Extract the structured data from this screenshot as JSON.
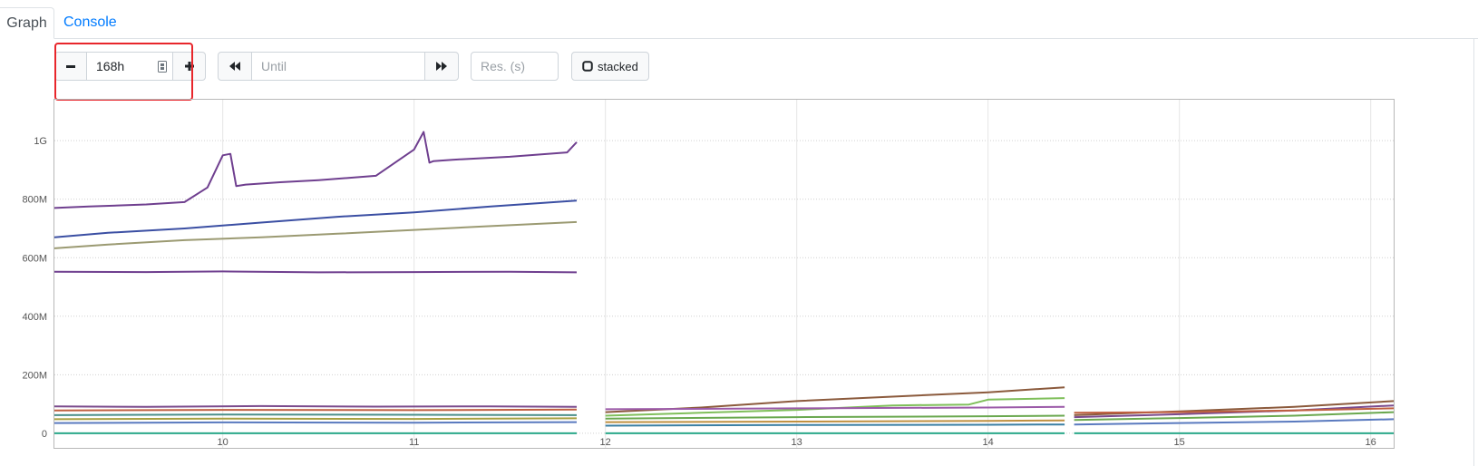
{
  "tabs": {
    "graph": "Graph",
    "console": "Console"
  },
  "controls": {
    "range_value": "168h",
    "until_placeholder": "Until",
    "resolution_placeholder": "Res. (s)",
    "stacked_label": "stacked"
  },
  "icons": {
    "minus": "minus-icon",
    "plus": "plus-icon",
    "calendar": "calendar-icon",
    "backward": "fast-backward-icon",
    "forward": "fast-forward-icon",
    "checkbox": "checkbox-icon"
  },
  "colors": {
    "highlight": "#e8262b",
    "link": "#007bff",
    "grid": "#d9d9d9"
  },
  "chart_data": {
    "type": "line",
    "ylim": [
      -50000000,
      1140000000
    ],
    "xlim": [
      9.12,
      16.12
    ],
    "y_ticks": [
      {
        "value": 0,
        "label": "0"
      },
      {
        "value": 200000000,
        "label": "200M"
      },
      {
        "value": 400000000,
        "label": "400M"
      },
      {
        "value": 600000000,
        "label": "600M"
      },
      {
        "value": 800000000,
        "label": "800M"
      },
      {
        "value": 1000000000,
        "label": "1G"
      }
    ],
    "x_ticks": [
      {
        "value": 10,
        "label": "10"
      },
      {
        "value": 11,
        "label": "11"
      },
      {
        "value": 12,
        "label": "12"
      },
      {
        "value": 13,
        "label": "13"
      },
      {
        "value": 14,
        "label": "14"
      },
      {
        "value": 15,
        "label": "15"
      },
      {
        "value": 16,
        "label": "16"
      }
    ],
    "series": [
      {
        "color": "#6f3f8f",
        "x": [
          9.12,
          9.3,
          9.6,
          9.8,
          9.92,
          10.0,
          10.04,
          10.07,
          10.12,
          10.3,
          10.5,
          10.8,
          11.0,
          11.05,
          11.08,
          11.1,
          11.2,
          11.5,
          11.8,
          11.85
        ],
        "y": [
          770000000,
          775000000,
          782000000,
          790000000,
          840000000,
          950000000,
          955000000,
          845000000,
          850000000,
          858000000,
          865000000,
          880000000,
          970000000,
          1030000000,
          925000000,
          930000000,
          935000000,
          945000000,
          960000000,
          995000000
        ]
      },
      {
        "color": "#3b4fa3",
        "x": [
          9.12,
          9.4,
          9.8,
          10.2,
          10.6,
          11.0,
          11.4,
          11.85
        ],
        "y": [
          670000000,
          685000000,
          700000000,
          720000000,
          740000000,
          755000000,
          775000000,
          795000000
        ]
      },
      {
        "color": "#9b9a72",
        "x": [
          9.12,
          9.4,
          9.8,
          10.2,
          10.6,
          11.0,
          11.4,
          11.85
        ],
        "y": [
          632000000,
          645000000,
          660000000,
          670000000,
          682000000,
          695000000,
          708000000,
          722000000
        ]
      },
      {
        "color": "#6f3f8f",
        "x": [
          9.12,
          9.6,
          10.0,
          10.5,
          11.0,
          11.5,
          11.85
        ],
        "y": [
          552000000,
          551000000,
          553000000,
          550000000,
          551000000,
          552000000,
          550000000
        ]
      },
      {
        "color": "#8b5a3c",
        "x": [
          12.0,
          12.5,
          13.0,
          13.5,
          14.0,
          14.4
        ],
        "y": [
          72000000,
          88000000,
          110000000,
          125000000,
          140000000,
          157000000
        ]
      },
      {
        "color": "#7fbf5a",
        "x": [
          12.0,
          12.5,
          13.0,
          13.5,
          13.9,
          14.0,
          14.4
        ],
        "y": [
          60000000,
          70000000,
          80000000,
          95000000,
          98000000,
          115000000,
          120000000
        ]
      },
      {
        "color": "#7a4a8c",
        "x": [
          9.12,
          9.6,
          10.2,
          10.8,
          11.4,
          11.85
        ],
        "y": [
          92000000,
          90000000,
          93000000,
          91000000,
          92000000,
          90000000
        ]
      },
      {
        "color": "#c06040",
        "x": [
          9.12,
          10.0,
          11.0,
          11.85
        ],
        "y": [
          78000000,
          80000000,
          79000000,
          81000000
        ]
      },
      {
        "color": "#4a8f8a",
        "x": [
          9.12,
          10.0,
          11.0,
          11.85
        ],
        "y": [
          62000000,
          64000000,
          63000000,
          62000000
        ]
      },
      {
        "color": "#a8a040",
        "x": [
          9.12,
          10.0,
          11.0,
          11.85
        ],
        "y": [
          48000000,
          50000000,
          49000000,
          51000000
        ]
      },
      {
        "color": "#5a7abf",
        "x": [
          9.12,
          10.0,
          11.0,
          11.85
        ],
        "y": [
          35000000,
          37000000,
          36000000,
          38000000
        ]
      },
      {
        "color": "#6aa84f",
        "x": [
          12.0,
          13.0,
          14.0,
          14.4
        ],
        "y": [
          50000000,
          55000000,
          58000000,
          60000000
        ]
      },
      {
        "color": "#9b5aa8",
        "x": [
          12.0,
          13.0,
          14.0,
          14.4
        ],
        "y": [
          82000000,
          85000000,
          88000000,
          90000000
        ]
      },
      {
        "color": "#c09040",
        "x": [
          12.0,
          13.0,
          14.0,
          14.4
        ],
        "y": [
          38000000,
          40000000,
          42000000,
          44000000
        ]
      },
      {
        "color": "#3b7fa3",
        "x": [
          12.0,
          13.0,
          14.0,
          14.4
        ],
        "y": [
          26000000,
          28000000,
          29000000,
          30000000
        ]
      },
      {
        "color": "#8b5a3c",
        "x": [
          14.45,
          15.0,
          15.6,
          16.12
        ],
        "y": [
          62000000,
          75000000,
          90000000,
          110000000
        ]
      },
      {
        "color": "#7a4a8c",
        "x": [
          14.45,
          15.0,
          15.6,
          16.12
        ],
        "y": [
          55000000,
          65000000,
          78000000,
          95000000
        ]
      },
      {
        "color": "#6aa84f",
        "x": [
          14.45,
          15.0,
          15.6,
          16.12
        ],
        "y": [
          45000000,
          52000000,
          60000000,
          72000000
        ]
      },
      {
        "color": "#5a7abf",
        "x": [
          14.45,
          15.0,
          15.6,
          16.12
        ],
        "y": [
          30000000,
          35000000,
          40000000,
          48000000
        ]
      },
      {
        "color": "#c06040",
        "x": [
          14.45,
          15.0,
          15.6,
          16.12
        ],
        "y": [
          70000000,
          72000000,
          78000000,
          85000000
        ]
      },
      {
        "color": "#2aa889",
        "x": [
          9.12,
          11.85
        ],
        "y": [
          0,
          0
        ]
      },
      {
        "color": "#2aa889",
        "x": [
          12.0,
          14.4
        ],
        "y": [
          0,
          0
        ]
      },
      {
        "color": "#2aa889",
        "x": [
          14.45,
          16.12
        ],
        "y": [
          0,
          0
        ]
      }
    ]
  }
}
